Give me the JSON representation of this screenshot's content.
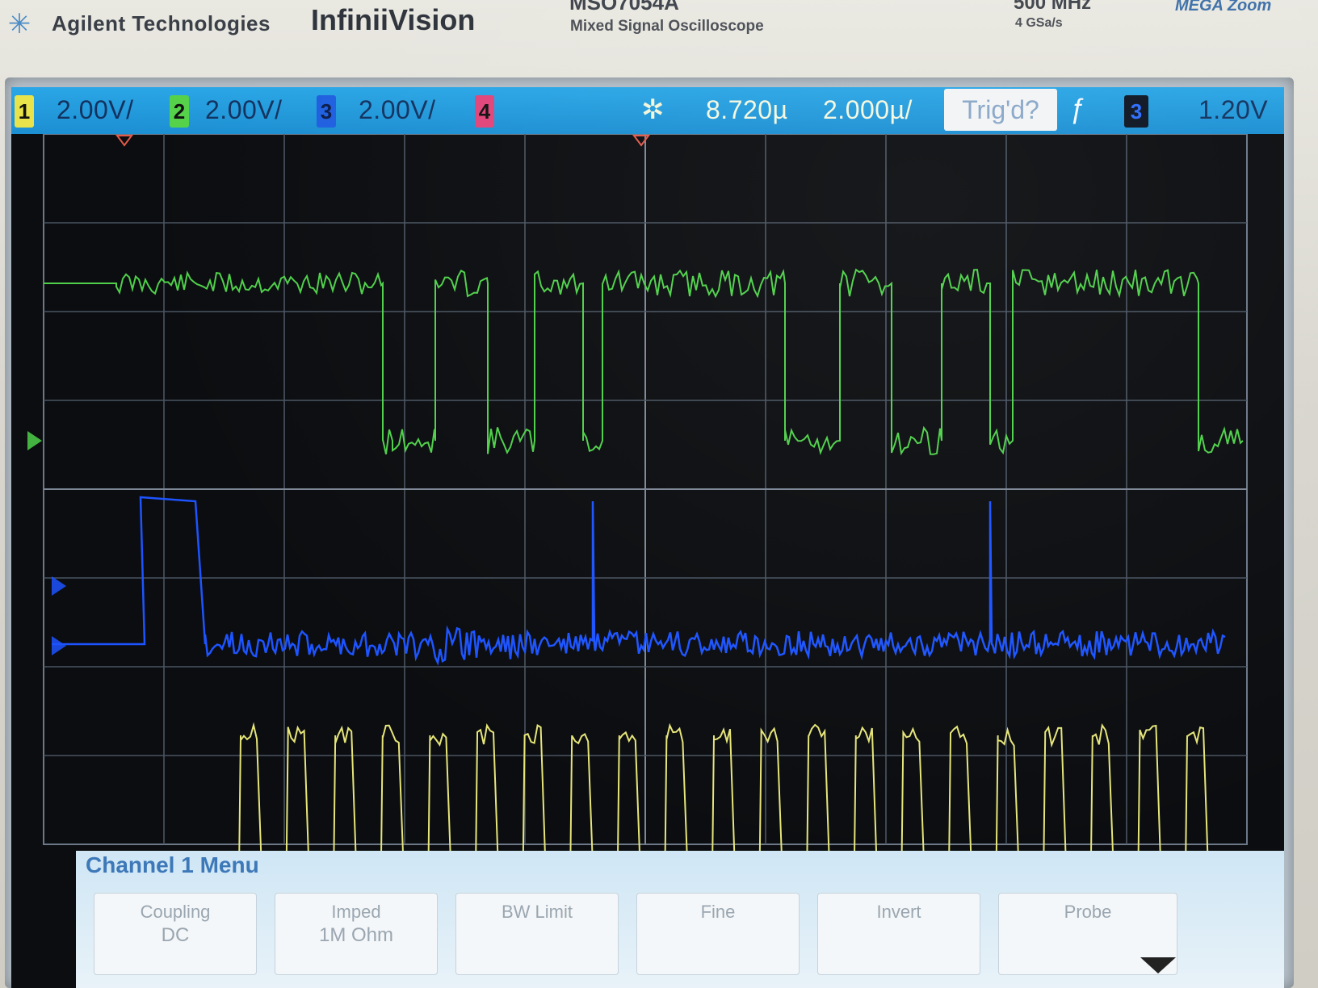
{
  "instrument": {
    "brand": "Agilent Technologies",
    "product_line": "InfiniiVision",
    "model": "MSO7054A",
    "model_subtitle": "Mixed Signal Oscilloscope",
    "bandwidth": "500 MHz",
    "sample_rate": "4 GSa/s",
    "feature_logo": "MEGA Zoom"
  },
  "status_bar": {
    "channels": [
      {
        "number": "1",
        "scale": "2.00V/",
        "color": "#e8e34a"
      },
      {
        "number": "2",
        "scale": "2.00V/",
        "color": "#55d24a"
      },
      {
        "number": "3",
        "scale": "2.00V/",
        "color": "#1f5fe0"
      },
      {
        "number": "4",
        "scale": "",
        "color": "#e0457a"
      }
    ],
    "time_delay": "8.720µ",
    "time_scale": "2.000µ/",
    "trigger_status": "Trig'd?",
    "trigger_source": "3",
    "trigger_level": "1.20V"
  },
  "waveforms": {
    "channel_1_color": "#e6e57a",
    "channel_2_color": "#4fd04a",
    "channel_3_color": "#1d54ff"
  },
  "menu": {
    "title": "Channel 1 Menu",
    "softkeys": [
      {
        "top": "Coupling",
        "bottom": "DC"
      },
      {
        "top": "Imped",
        "bottom": "1M Ohm"
      },
      {
        "top": "BW Limit",
        "bottom": ""
      },
      {
        "top": "Fine",
        "bottom": ""
      },
      {
        "top": "Invert",
        "bottom": ""
      },
      {
        "top": "Probe",
        "bottom": ""
      }
    ]
  }
}
